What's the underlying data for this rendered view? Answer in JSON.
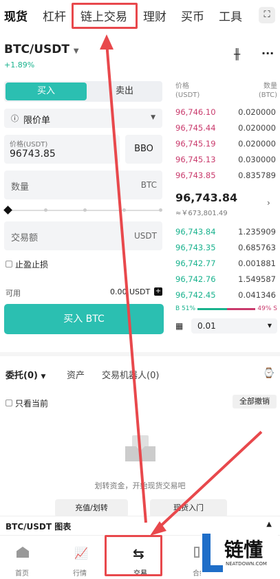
{
  "tabs": [
    "现货",
    "杠杆",
    "链上交易",
    "理财",
    "买币",
    "工具"
  ],
  "pair": "BTC/USDT",
  "change": "+1.89%",
  "side": {
    "buy": "买入",
    "sell": "卖出"
  },
  "order_type": "限价单",
  "price": {
    "label": "价格(USDT)",
    "value": "96743.85",
    "bbo": "BBO"
  },
  "qty": {
    "label": "数量",
    "unit": "BTC"
  },
  "amount": {
    "label": "交易额",
    "unit": "USDT"
  },
  "tpsl": "止盈止损",
  "available": {
    "label": "可用",
    "value": "0.00 USDT"
  },
  "buy_btn": "买入 BTC",
  "ob": {
    "price_head": "价格",
    "price_unit": "(USDT)",
    "qty_head": "数量",
    "qty_unit": "(BTC)",
    "asks": [
      [
        "96,746.10",
        "0.020000"
      ],
      [
        "96,745.44",
        "0.020000"
      ],
      [
        "96,745.19",
        "0.020000"
      ],
      [
        "96,745.13",
        "0.030000"
      ],
      [
        "96,743.85",
        "0.835789"
      ]
    ],
    "last": "96,743.84",
    "last_cny": "≈￥673,801.49",
    "bids": [
      [
        "96,743.84",
        "1.235909"
      ],
      [
        "96,743.35",
        "0.685763"
      ],
      [
        "96,742.77",
        "0.001881"
      ],
      [
        "96,742.76",
        "1.549587"
      ],
      [
        "96,742.45",
        "0.041346"
      ]
    ],
    "b_pct": "B 51%",
    "s_pct": "49% S",
    "depth": "0.01"
  },
  "orders": {
    "tab": "委托(0)",
    "assets": "资产",
    "bot": "交易机器人(0)",
    "only_current": "只看当前",
    "cancel_all": "全部撤销",
    "empty": "划转资金，开始现货交易吧",
    "btn1": "充值/划转",
    "btn2": "现货入门"
  },
  "chart_bar": "BTC/USDT 图表",
  "nav": [
    "首页",
    "行情",
    "交易",
    "合约"
  ],
  "logo": {
    "text": "链懂",
    "sub": "NEATDOWN.COM"
  }
}
